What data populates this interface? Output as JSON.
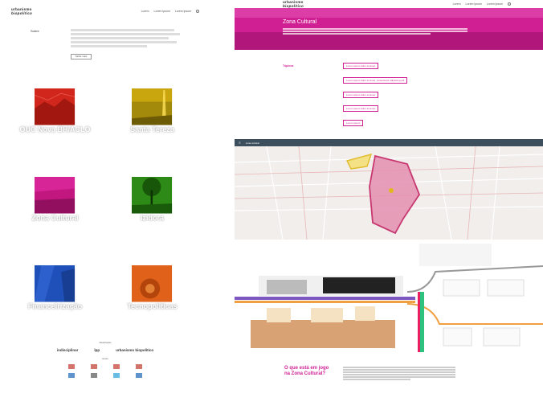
{
  "left": {
    "logo_line1": "urbanismo",
    "logo_line2": "biopolítico",
    "nav": [
      "Lorem",
      "Lorem ipsum",
      "Lorem ipsum"
    ],
    "intro_label": "Sobre",
    "intro_button": "Saiba mais",
    "tiles": [
      {
        "title": "OUC Nova BH/ACLO",
        "color": "#d1261c"
      },
      {
        "title": "Santa Tereza",
        "color": "#c9a50e"
      },
      {
        "title": "Zona Cultural",
        "color": "#c2177f"
      },
      {
        "title": "Izidora",
        "color": "#2e8a16"
      },
      {
        "title": "Financeirização",
        "color": "#1f4fb8"
      },
      {
        "title": "Tecnopolíticas",
        "color": "#e0621a"
      }
    ],
    "footer": {
      "caption1": "Realização",
      "logos": [
        "indisciplinar",
        "lpp",
        "urbanismo biopolítico"
      ],
      "caption2": "Apoio"
    }
  },
  "right": {
    "logo_line1": "urbanismo",
    "logo_line2": "biopolítico",
    "nav": [
      "Lorem",
      "Lorem ipsum",
      "Lorem ipsum"
    ],
    "hero_title": "Zona Cultural",
    "topics_label": "Tópicos",
    "tags": [
      "Lorem ipsum dolor sit amet",
      "Lorem ipsum dolor sit amet, consectetur adipiscing elit",
      "Lorem ipsum dolor sit amet",
      "Lorem ipsum dolor sit amet",
      "Lorem ipsum"
    ],
    "map_title": "zona cultural",
    "question": "O que está em jogo na Zona Cultural?"
  }
}
